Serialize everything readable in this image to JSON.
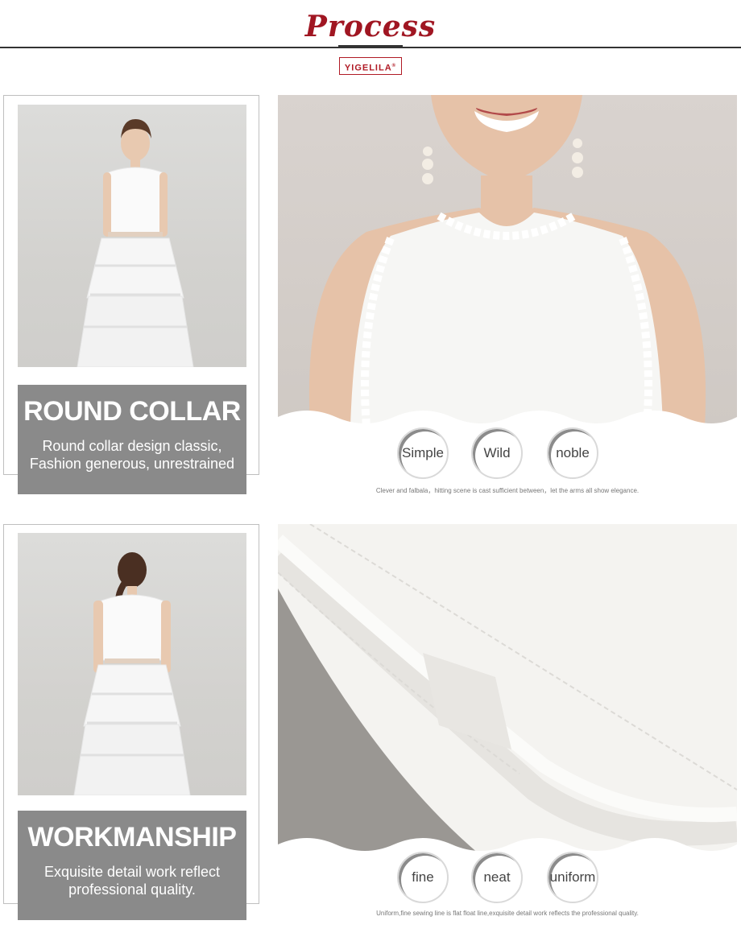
{
  "header": {
    "title": "Process",
    "brand": "YIGELILA",
    "brand_mark": "®"
  },
  "sections": [
    {
      "label_title": "ROUND COLLAR",
      "label_desc_1": "Round collar design classic,",
      "label_desc_2": "Fashion generous, unrestrained",
      "tags": [
        "Simple",
        "Wild",
        "noble"
      ],
      "caption": "Clever and falbala，hitting scene is cast sufficient between，let the arms all show elegance."
    },
    {
      "label_title": "WORKMANSHIP",
      "label_desc_1": "Exquisite detail work reflect",
      "label_desc_2": "professional quality.",
      "tags": [
        "fine",
        "neat",
        "uniform"
      ],
      "caption": "Uniform,fine sewing line is flat float line,exquisite detail work reflects the professional quality."
    }
  ],
  "colors": {
    "accent": "#a01622",
    "label_bg": "#8a8a8a",
    "photo_bg": "#d6d5d2"
  }
}
